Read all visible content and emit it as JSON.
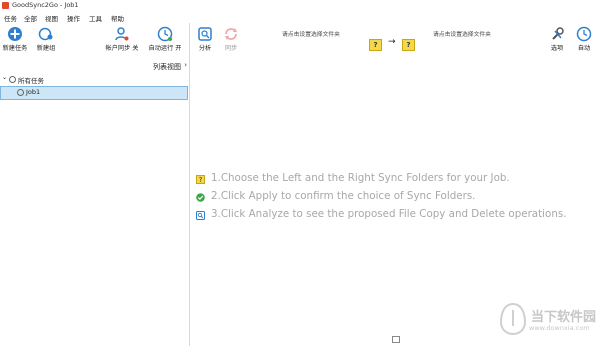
{
  "window": {
    "title": "GoodSync2Go - Job1"
  },
  "menu": [
    "任务",
    "全部",
    "视图",
    "操作",
    "工具",
    "帮助"
  ],
  "toolbar_left": {
    "new_job": "新建任务",
    "new_group": "新建组",
    "account_sync": "帐户同步 关",
    "auto_run": "自动运行 开"
  },
  "toolbar_right": {
    "analyze": "分析",
    "sync": "同步",
    "left_folder_hint": "请点击设置选择文件夹",
    "right_folder_hint": "请点击设置选择文件夹",
    "left_folder_box": "?",
    "right_folder_box": "?",
    "options": "选项",
    "auto": "自动"
  },
  "left_pane": {
    "list_view": "列表视图",
    "all_jobs": "所有任务",
    "jobs": [
      "Job1"
    ]
  },
  "instructions": [
    "1.Choose the Left and the Right Sync Folders for your Job.",
    "2.Click Apply to confirm the choice of Sync Folders.",
    "3.Click Analyze to see the proposed File Copy and Delete operations."
  ],
  "watermark": {
    "title": "当下软件园",
    "subtitle": "www.downxia.com"
  },
  "colors": {
    "accent_blue": "#2d7fd0",
    "selection": "#cde6f7",
    "instruction_text": "#a8a8a8",
    "folder_yellow": "#f5d84a",
    "check_green": "#3aa84a"
  }
}
